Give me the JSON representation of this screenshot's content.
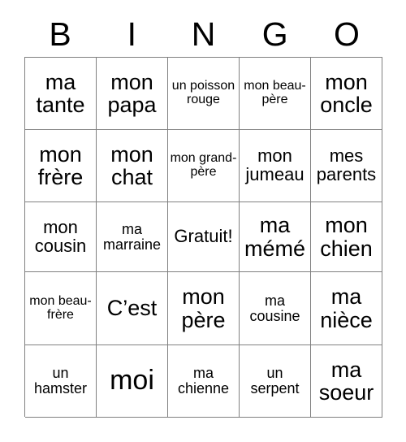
{
  "card": {
    "title": "BINGO card",
    "header_letters": [
      "B",
      "I",
      "N",
      "G",
      "O"
    ],
    "grid_line_color": "#808080",
    "text_color": "#000000",
    "background_color": "#ffffff",
    "rows": [
      [
        {
          "text": "ma tante",
          "size": "lg"
        },
        {
          "text": "mon papa",
          "size": "lg"
        },
        {
          "text": "un poisson rouge",
          "size": "xs"
        },
        {
          "text": "mon beau-père",
          "size": "xs"
        },
        {
          "text": "mon oncle",
          "size": "lg"
        }
      ],
      [
        {
          "text": "mon frère",
          "size": "lg"
        },
        {
          "text": "mon chat",
          "size": "lg"
        },
        {
          "text": "mon grand-père",
          "size": "xs"
        },
        {
          "text": "mon jumeau",
          "size": "md"
        },
        {
          "text": "mes parents",
          "size": "md"
        }
      ],
      [
        {
          "text": "mon cousin",
          "size": "md"
        },
        {
          "text": "ma marraine",
          "size": "sm"
        },
        {
          "text": "Gratuit!",
          "size": "md"
        },
        {
          "text": "ma mémé",
          "size": "lg"
        },
        {
          "text": "mon chien",
          "size": "lg"
        }
      ],
      [
        {
          "text": "mon beau-frère",
          "size": "xs"
        },
        {
          "text": "C’est",
          "size": "lg"
        },
        {
          "text": "mon père",
          "size": "lg"
        },
        {
          "text": "ma cousine",
          "size": "sm"
        },
        {
          "text": "ma nièce",
          "size": "lg"
        }
      ],
      [
        {
          "text": "un hamster",
          "size": "sm"
        },
        {
          "text": "moi",
          "size": "xl"
        },
        {
          "text": "ma chienne",
          "size": "sm"
        },
        {
          "text": "un serpent",
          "size": "sm"
        },
        {
          "text": "ma soeur",
          "size": "lg"
        }
      ]
    ]
  }
}
